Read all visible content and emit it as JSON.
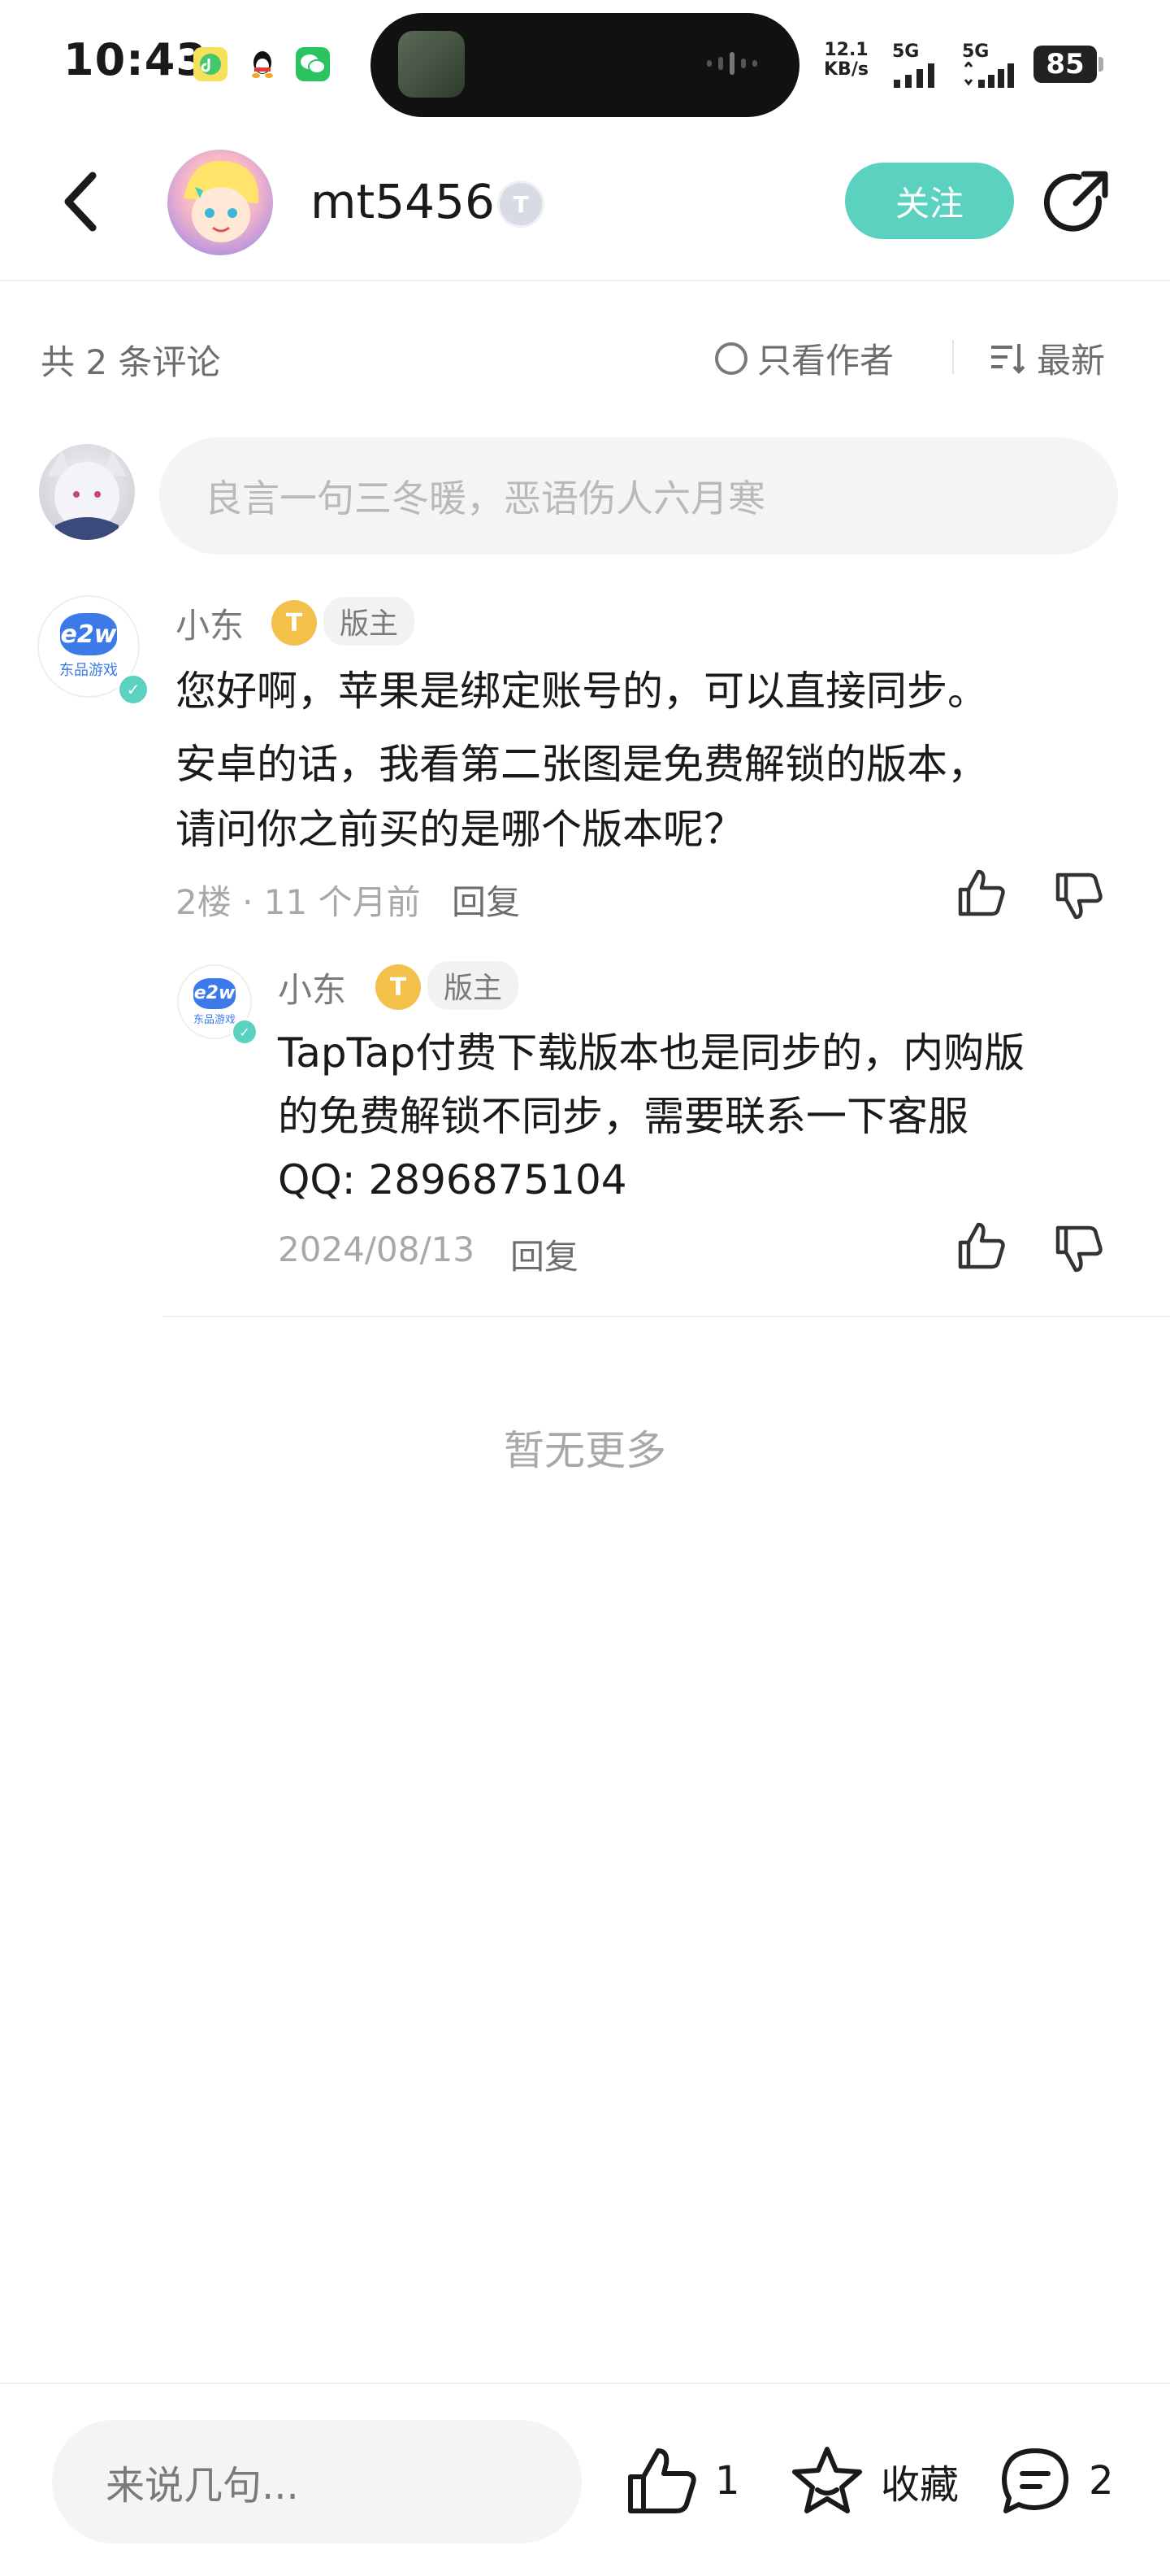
{
  "status_bar": {
    "time": "10:43",
    "net_speed_value": "12.1",
    "net_speed_unit": "KB/s",
    "signal1": "5G",
    "signal2": "5G",
    "battery": "85"
  },
  "header": {
    "username": "mt5456",
    "level_badge": "T",
    "follow_label": "关注"
  },
  "filters": {
    "count_label": "共 2 条评论",
    "only_author_label": "只看作者",
    "sort_label": "最新"
  },
  "composer": {
    "placeholder": "良言一句三冬暖，恶语伤人六月寒"
  },
  "comments": [
    {
      "author": "小东",
      "coin": "T",
      "role": "版主",
      "avatar_logo": "e2w",
      "avatar_text": "东品游戏",
      "lines": [
        "您好啊，苹果是绑定账号的，可以直接同步。",
        "安卓的话，我看第二张图是免费解锁的版本，",
        "请问你之前买的是哪个版本呢？"
      ],
      "meta": "2楼 · 11 个月前",
      "reply_label": "回复"
    }
  ],
  "reply": {
    "author": "小东",
    "coin": "T",
    "role": "版主",
    "avatar_logo": "e2w",
    "avatar_text": "东品游戏",
    "lines": [
      "TapTap付费下载版本也是同步的，内购版",
      "的免费解锁不同步，需要联系一下客服",
      "QQ: 2896875104"
    ],
    "meta": "2024/08/13",
    "reply_label": "回复"
  },
  "no_more": "暂无更多",
  "bottom_bar": {
    "input_placeholder": "来说几句...",
    "like_count": "1",
    "collect_label": "收藏",
    "comment_count": "2"
  },
  "colors": {
    "accent": "#5bd2bf",
    "text": "#1a1a1a",
    "muted": "#a8a8a8"
  }
}
